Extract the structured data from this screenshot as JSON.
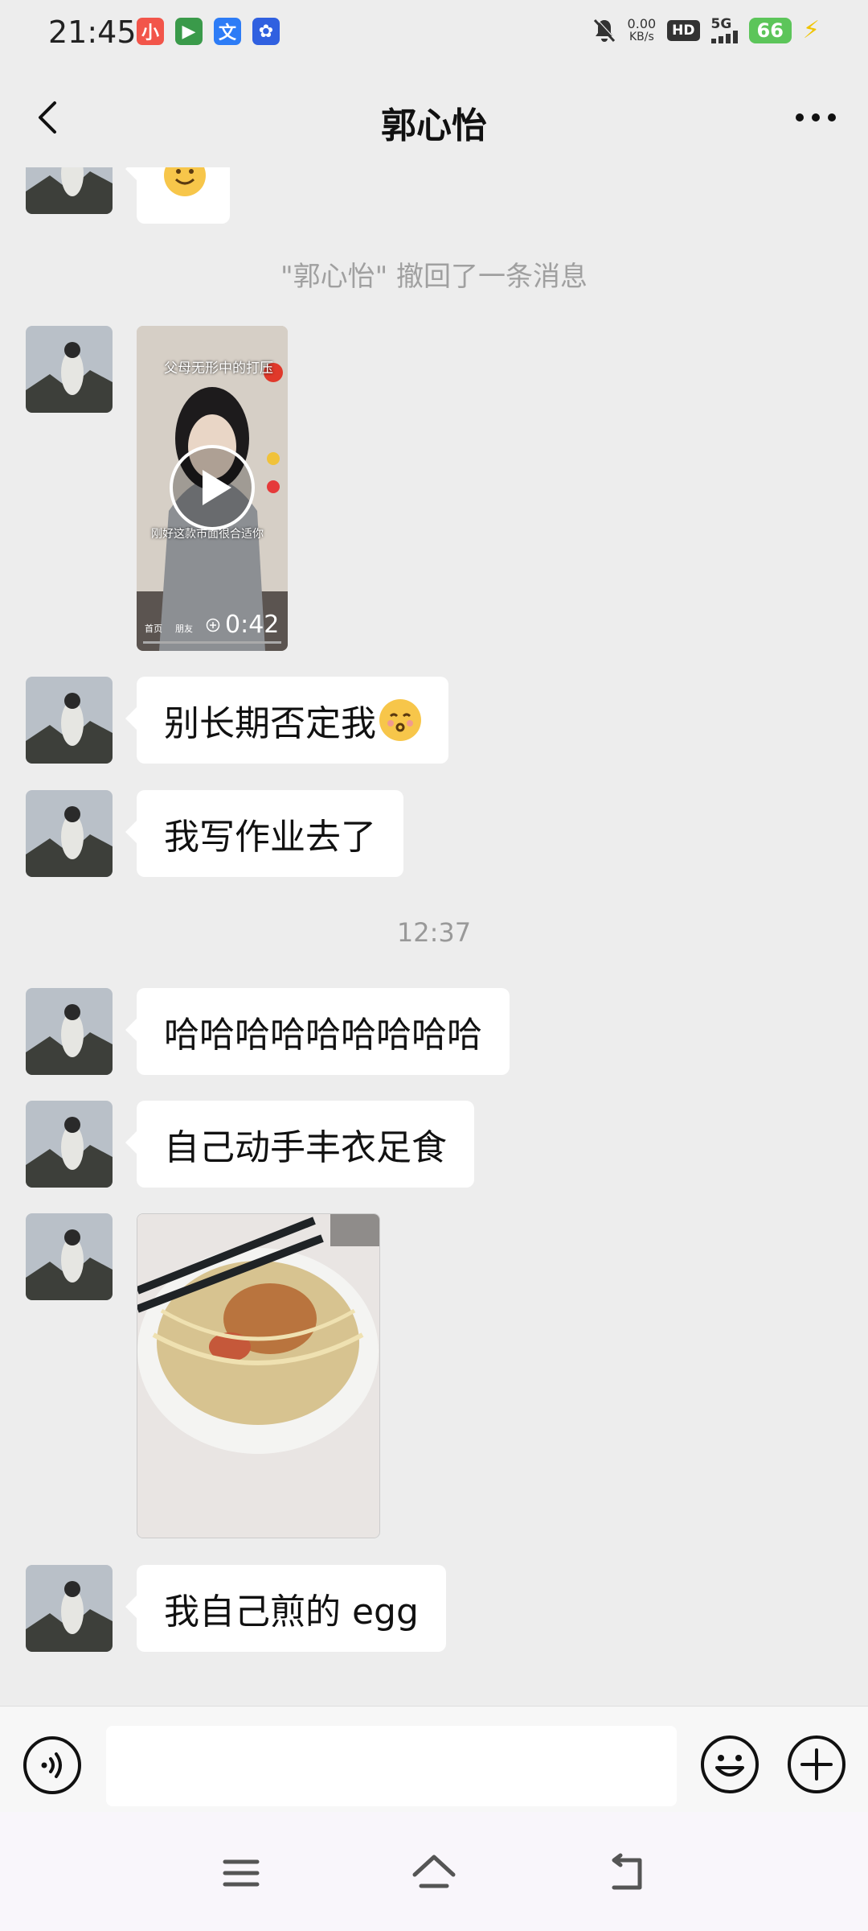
{
  "status_bar": {
    "time": "21:45",
    "net_speed_value": "0.00",
    "net_speed_unit": "KB/s",
    "hd_label": "HD",
    "network_label": "5G",
    "battery_level": "66",
    "icons": [
      "xiaohongshu-app-icon",
      "game-app-icon",
      "translate-app-icon",
      "baidu-app-icon",
      "mute-icon",
      "signal-icon",
      "battery-icon",
      "charging-icon"
    ]
  },
  "header": {
    "title": "郭心怡"
  },
  "messages": {
    "recall_notice": "\"郭心怡\" 撤回了一条消息",
    "video": {
      "overlay_title": "父母无形中的打压",
      "overlay_caption": "刚好这款市面很合适你",
      "duration": "0:42",
      "tab_home": "首页",
      "tab_friends": "朋友"
    },
    "bubble_1": "别长期否定我",
    "bubble_2": "我写作业去了",
    "time_1": "12:37",
    "bubble_3": "哈哈哈哈哈哈哈哈哈",
    "bubble_4": "自己动手丰衣足食",
    "bubble_5": "我自己煎的 egg"
  },
  "colors": {
    "background": "#ededed",
    "bubble": "#ffffff",
    "battery": "#5cc55a",
    "system_text": "#a0a0a0"
  }
}
